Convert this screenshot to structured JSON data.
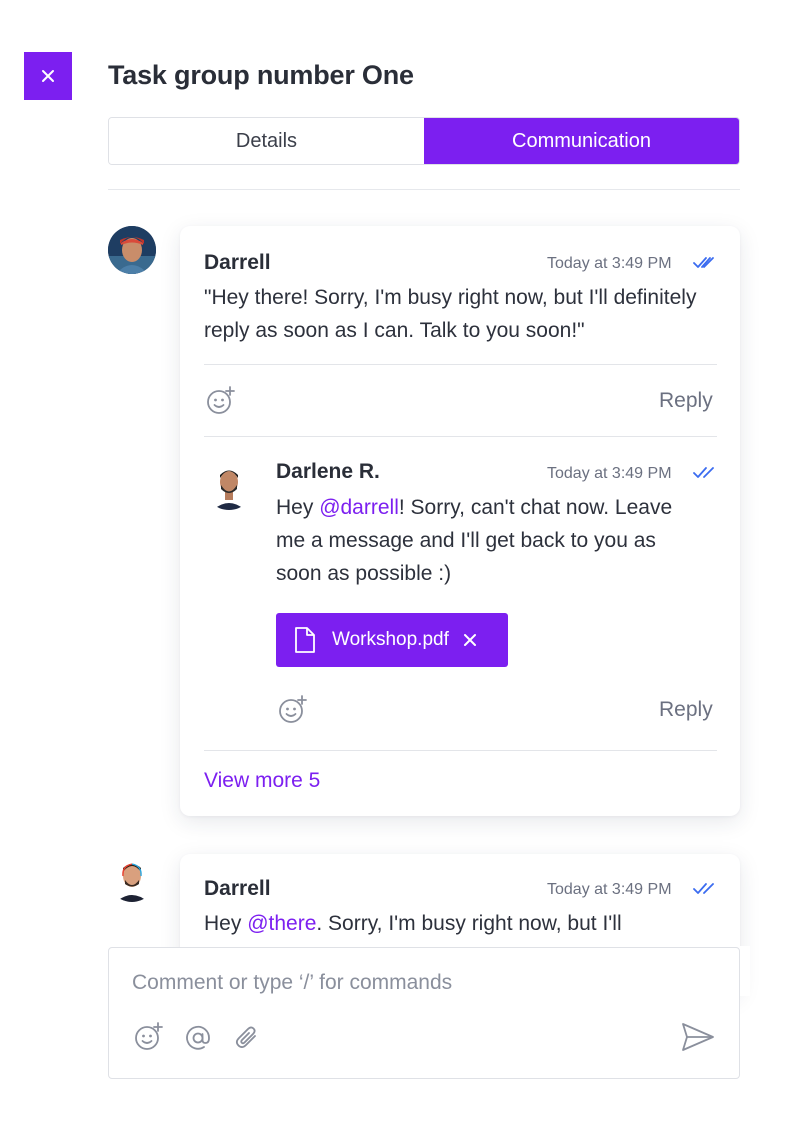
{
  "header": {
    "title": "Task group number One",
    "close_icon": "close-icon"
  },
  "tabs": [
    {
      "label": "Details",
      "active": false
    },
    {
      "label": "Communication",
      "active": true
    }
  ],
  "thread": {
    "comment": {
      "author": "Darrell",
      "time": "Today at 3:49 PM",
      "text": "\"Hey there! Sorry, I'm busy right now, but I'll definitely reply as soon as I can. Talk to you soon!\"",
      "reply_label": "Reply"
    },
    "reply": {
      "author": "Darlene R.",
      "time": "Today at 3:49 PM",
      "text_before": "Hey ",
      "mention": "@darrell",
      "text_after": "! Sorry, can't chat now. Leave me a message and I'll get back to you as soon as possible :)",
      "attachment": "Workshop.pdf",
      "reply_label": "Reply"
    },
    "view_more": "View more 5"
  },
  "second_comment": {
    "author": "Darrell",
    "time": "Today at 3:49 PM",
    "text_before": "Hey ",
    "mention": "@there",
    "text_after": ". Sorry, I'm busy right now, but I'll"
  },
  "composer": {
    "placeholder": "Comment or type ‘/’ for commands"
  },
  "colors": {
    "accent": "#7c1ff0",
    "read_check": "#3b6cf0"
  }
}
